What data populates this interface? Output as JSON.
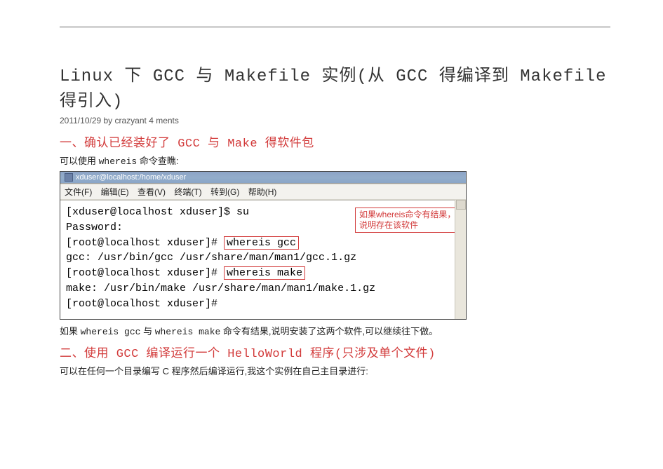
{
  "title": "Linux 下 GCC 与 Makefile 实例(从 GCC 得编译到 Makefile 得引入)",
  "meta": "2011/10/29 by crazyant 4 ments",
  "h1": "一、确认已经装好了 GCC 与 Make 得软件包",
  "p1_a": "可以使用 ",
  "p1_b": "whereis",
  "p1_c": " 命令查瞧:",
  "terminal": {
    "titlebar": "xduser@localhost:/home/xduser",
    "menus": [
      "文件(F)",
      "编辑(E)",
      "查看(V)",
      "终端(T)",
      "转到(G)",
      "帮助(H)"
    ],
    "lines": {
      "l1": "[xduser@localhost xduser]$ su",
      "l2": "Password:",
      "l3_a": "[root@localhost xduser]# ",
      "l3_b": "whereis gcc",
      "l4": "gcc: /usr/bin/gcc /usr/share/man/man1/gcc.1.gz",
      "l5_a": "[root@localhost xduser]# ",
      "l5_b": "whereis make",
      "l6": "make: /usr/bin/make /usr/share/man/man1/make.1.gz",
      "l7": "[root@localhost xduser]#"
    },
    "annot": "如果whereis命令有结果，说明存在该软件"
  },
  "p2_a": "如果 ",
  "p2_b": "whereis   gcc",
  "p2_c": " 与 ",
  "p2_d": "whereis   make",
  "p2_e": " 命令有结果,说明安装了这两个软件,可以继续往下做。",
  "h2": "二、使用 GCC 编译运行一个 HelloWorld 程序(只涉及单个文件)",
  "p3": "可以在任何一个目录编写 C 程序然后编译运行,我这个实例在自己主目录进行:"
}
